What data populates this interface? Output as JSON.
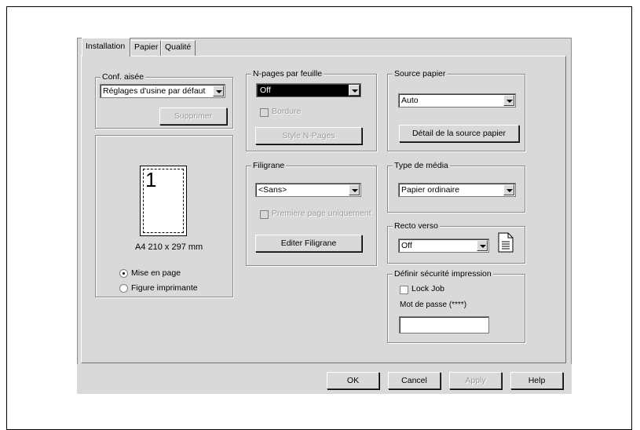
{
  "tabs": [
    "Installation",
    "Papier",
    "Qualité"
  ],
  "conf_aisee": {
    "legend": "Conf. aisée",
    "value": "Réglages d'usine par défaut",
    "delete_label": "Supprimer"
  },
  "preview": {
    "page_number": "1",
    "paper_size": "A4 210 x 297 mm",
    "radio_layout": "Mise en page",
    "radio_printer": "Figure imprimante",
    "selected": "Mise en page"
  },
  "npages": {
    "legend": "N-pages par feuille",
    "value": "Off",
    "border_label": "Bordure",
    "style_label": "Style N-Pages"
  },
  "filigrane": {
    "legend": "Filigrane",
    "value": "<Sans>",
    "first_page_label": "Premiere page uniquement",
    "edit_label": "Editer Filigrane"
  },
  "source": {
    "legend": "Source papier",
    "value": "Auto",
    "detail_label": "Détail de la source papier"
  },
  "media": {
    "legend": "Type de média",
    "value": "Papier ordinaire"
  },
  "duplex": {
    "legend": "Recto verso",
    "value": "Off"
  },
  "security": {
    "legend": "Définir sécurité impression",
    "lock_job_label": "Lock Job",
    "password_label": "Mot de passe (****)",
    "password_value": ""
  },
  "buttons": {
    "ok": "OK",
    "cancel": "Cancel",
    "apply": "Apply",
    "help": "Help"
  }
}
